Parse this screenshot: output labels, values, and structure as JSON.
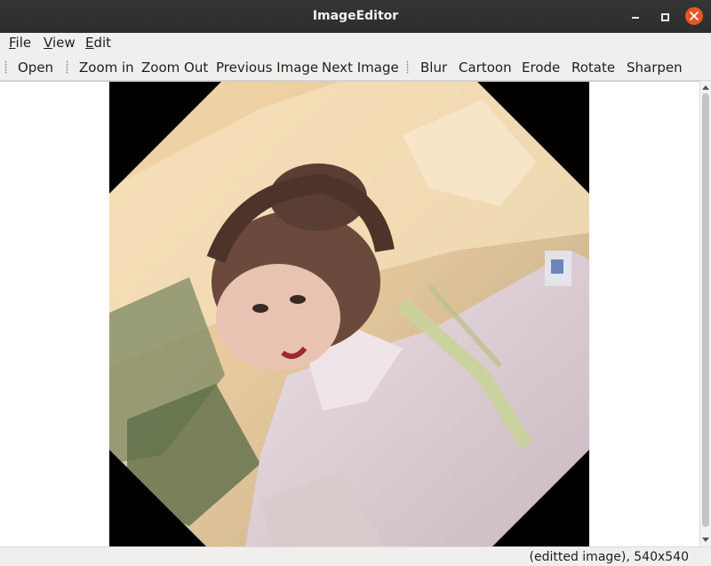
{
  "window": {
    "title": "ImageEditor"
  },
  "menu": [
    {
      "key": "F",
      "rest": "ile"
    },
    {
      "key": "V",
      "rest": "iew"
    },
    {
      "key": "E",
      "rest": "dit"
    }
  ],
  "toolbar": {
    "file_group": [
      "Open"
    ],
    "view_group": [
      "Zoom in",
      "Zoom Out",
      "Previous Image",
      "Next Image"
    ],
    "edit_group": [
      "Blur",
      "Cartoon",
      "Erode",
      "Rotate",
      "Sharpen"
    ]
  },
  "image": {
    "description": "rotated photo of a person in a white shirt with a lanyard",
    "icon": "image-icon"
  },
  "status": {
    "text": "(editted image), 540x540"
  },
  "colors": {
    "titlebar": "#2d2d2d",
    "close_button": "#e95420",
    "canvas_background": "#000000"
  }
}
